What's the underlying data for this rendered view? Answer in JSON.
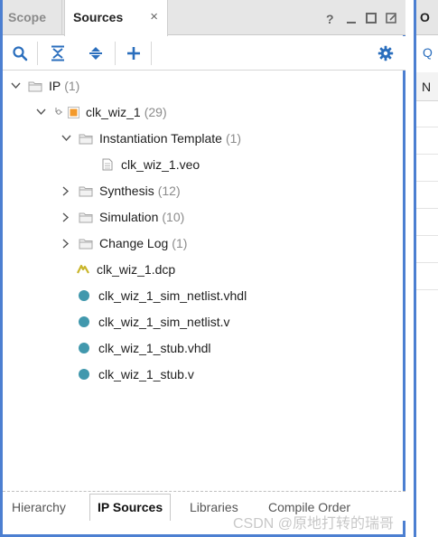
{
  "tabs": {
    "scope": "Scope",
    "sources": "Sources",
    "close_glyph": "×"
  },
  "window_controls": {
    "help": "?",
    "minimize": "—",
    "maximize": "□",
    "float": "⧉"
  },
  "tree": {
    "ip": {
      "label": "IP",
      "count": "(1)"
    },
    "clk_wiz": {
      "label": "clk_wiz_1",
      "count": "(29)"
    },
    "instantiation": {
      "label": "Instantiation Template",
      "count": "(1)"
    },
    "veo": {
      "label": "clk_wiz_1.veo"
    },
    "synthesis": {
      "label": "Synthesis",
      "count": "(12)"
    },
    "simulation": {
      "label": "Simulation",
      "count": "(10)"
    },
    "changelog": {
      "label": "Change Log",
      "count": "(1)"
    },
    "dcp": {
      "label": "clk_wiz_1.dcp"
    },
    "sim_vhdl": {
      "label": "clk_wiz_1_sim_netlist.vhdl"
    },
    "sim_v": {
      "label": "clk_wiz_1_sim_netlist.v"
    },
    "stub_vhdl": {
      "label": "clk_wiz_1_stub.vhdl"
    },
    "stub_v": {
      "label": "clk_wiz_1_stub.v"
    }
  },
  "bottom_tabs": {
    "hierarchy": "Hierarchy",
    "ip_sources": "IP Sources",
    "libraries": "Libraries",
    "compile_order": "Compile Order"
  },
  "right_panel": {
    "tab_letter": "O",
    "search_glyph": "Q",
    "header_letter": "N"
  },
  "watermark": "CSDN @原地打转的瑞哥",
  "colors": {
    "accent_border": "#4c7fd1",
    "toolbar_icon": "#2a6ebd",
    "hdl_dot": "#4198ad",
    "ip_orange": "#f39a2c"
  }
}
